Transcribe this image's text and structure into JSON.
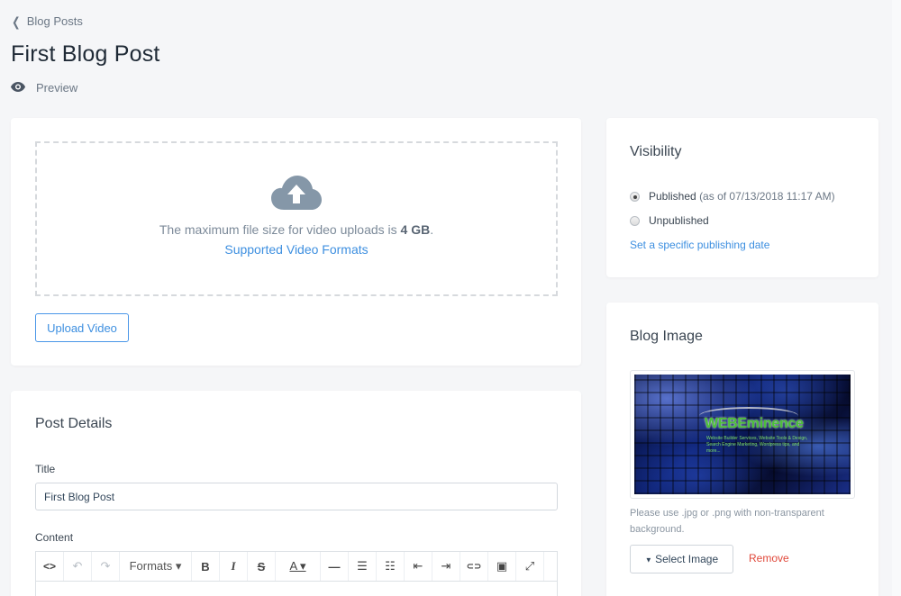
{
  "breadcrumb": {
    "label": "Blog Posts",
    "icon": "chevron-left-icon"
  },
  "page": {
    "title": "First Blog Post",
    "preview_label": "Preview",
    "preview_icon": "eye-icon"
  },
  "video": {
    "upload_icon": "cloud-upload-icon",
    "max_size_prefix": "The maximum file size for video uploads is ",
    "max_size_value": "4 GB",
    "max_size_suffix": ".",
    "formats_link": "Supported Video Formats",
    "upload_button": "Upload Video"
  },
  "post_details": {
    "heading": "Post Details",
    "title_label": "Title",
    "title_value": "First Blog Post",
    "content_label": "Content",
    "toolbar": [
      {
        "name": "source-code",
        "glyph": "<>"
      },
      {
        "name": "undo",
        "glyph": "↶",
        "disabled": true
      },
      {
        "name": "redo",
        "glyph": "↷",
        "disabled": true
      },
      {
        "name": "formats",
        "glyph": "Formats ▾"
      },
      {
        "name": "bold",
        "glyph": "B"
      },
      {
        "name": "italic",
        "glyph": "I"
      },
      {
        "name": "strikethrough",
        "glyph": "S"
      },
      {
        "name": "text-color",
        "glyph": "A ▾"
      },
      {
        "name": "horizontal-rule",
        "glyph": "—"
      },
      {
        "name": "bullet-list",
        "glyph": "☰"
      },
      {
        "name": "numbered-list",
        "glyph": "☷"
      },
      {
        "name": "outdent",
        "glyph": "⇤"
      },
      {
        "name": "indent",
        "glyph": "⇥"
      },
      {
        "name": "link",
        "glyph": "⊂⊃"
      },
      {
        "name": "image",
        "glyph": "▣"
      },
      {
        "name": "fullscreen",
        "glyph": "⤢"
      }
    ]
  },
  "visibility": {
    "heading": "Visibility",
    "options": [
      {
        "label": "Published",
        "detail": "(as of 07/13/2018 11:17 AM)",
        "checked": true
      },
      {
        "label": "Unpublished",
        "detail": "",
        "checked": false
      }
    ],
    "schedule_link": "Set a specific publishing date"
  },
  "blog_image": {
    "heading": "Blog Image",
    "image_logo_text": "WEBEminence",
    "image_tagline": "Website Builder Services, Website Tools & Design, Search Engine Marketing, Wordpress tips, and more...",
    "help_text": "Please use .jpg or .png with non-transparent background.",
    "select_button": "Select Image",
    "remove_link": "Remove"
  },
  "colors": {
    "accent": "#3d8fe0",
    "danger": "#e0483a",
    "background": "#f5f6f8"
  }
}
